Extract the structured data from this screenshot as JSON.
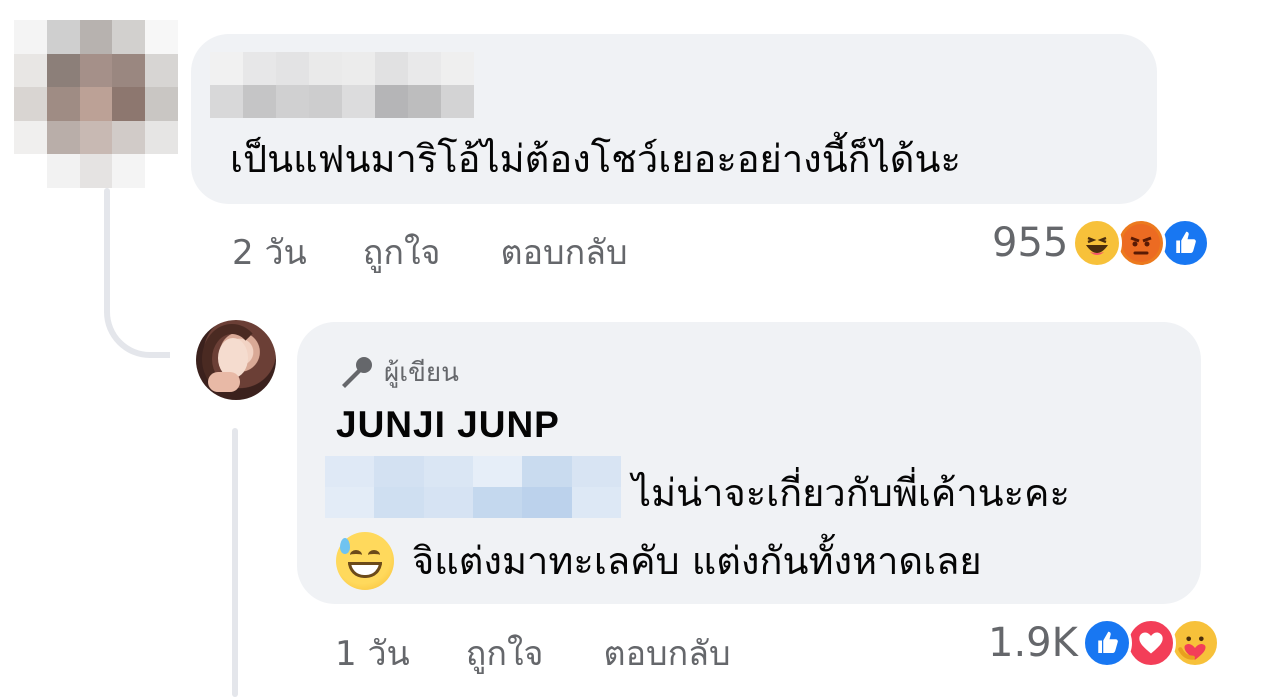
{
  "comment1": {
    "text": "เป็นแฟนมาริโอ้ไม่ต้องโชว์เยอะอย่างนี้ก็ได้นะ",
    "time": "2 วัน",
    "like_label": "ถูกใจ",
    "reply_label": "ตอบกลับ",
    "reaction_count": "955",
    "reactions": [
      "haha-icon",
      "angry-icon",
      "like-icon"
    ]
  },
  "comment2": {
    "badge": "ผู้เขียน",
    "badge_icon": "microphone-icon",
    "author": "JUNJI JUNP",
    "text_line1": "ไม่น่าจะเกี่ยวกับพี่เค้านะคะ",
    "text_line2": "จิแต่งมาทะเลคับ แต่งกันทั้งหาดเลย",
    "emoji": "sweat-smile-emoji",
    "time": "1 วัน",
    "like_label": "ถูกใจ",
    "reply_label": "ตอบกลับ",
    "reaction_count": "1.9K",
    "reactions": [
      "like-icon",
      "love-icon",
      "care-icon"
    ]
  },
  "colors": {
    "bubble": "#f0f2f5",
    "secondary_text": "#65676b",
    "like_blue": "#1877f2",
    "love_red": "#f33e58",
    "angry_orange": "#e9710f",
    "haha_yellow": "#f7b125"
  }
}
